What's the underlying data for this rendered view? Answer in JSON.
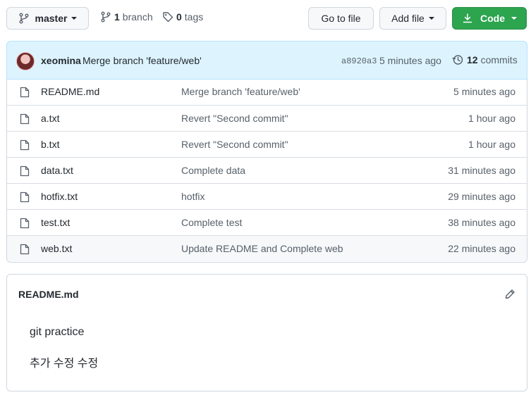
{
  "topbar": {
    "branch_select": "master",
    "branch_count": "1",
    "branch_word": "branch",
    "tag_count": "0",
    "tag_word": "tags",
    "go_to_file": "Go to file",
    "add_file": "Add file",
    "code": "Code"
  },
  "commit": {
    "author": "xeomina",
    "message": "Merge branch 'feature/web'",
    "sha": "a8920a3",
    "time": "5 minutes ago",
    "count": "12",
    "count_label": "commits"
  },
  "files": [
    {
      "name": "README.md",
      "message": "Merge branch 'feature/web'",
      "age": "5 minutes ago"
    },
    {
      "name": "a.txt",
      "message": "Revert \"Second commit\"",
      "age": "1 hour ago"
    },
    {
      "name": "b.txt",
      "message": "Revert \"Second commit\"",
      "age": "1 hour ago"
    },
    {
      "name": "data.txt",
      "message": "Complete data",
      "age": "31 minutes ago"
    },
    {
      "name": "hotfix.txt",
      "message": "hotfix",
      "age": "29 minutes ago"
    },
    {
      "name": "test.txt",
      "message": "Complete test",
      "age": "38 minutes ago"
    },
    {
      "name": "web.txt",
      "message": "Update README and Complete web",
      "age": "22 minutes ago"
    }
  ],
  "readme": {
    "title": "README.md",
    "lines": [
      "git practice",
      "추가 수정 수정"
    ]
  },
  "colors": {
    "code_button": "#2da44e",
    "commit_bar": "#ddf4ff"
  }
}
